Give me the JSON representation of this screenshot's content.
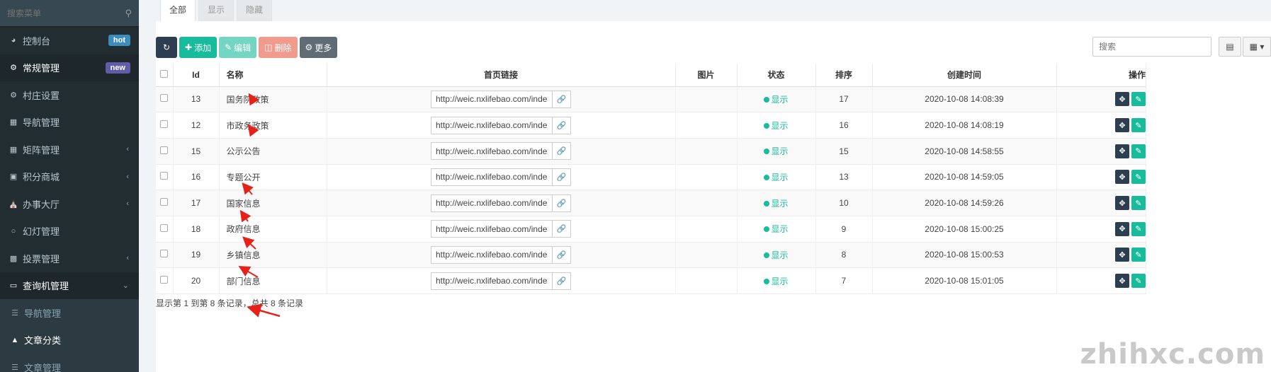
{
  "sidebar": {
    "search_placeholder": "搜索菜单",
    "items": [
      {
        "label": "控制台",
        "icon": "dashboard-icon",
        "badge": "hot"
      },
      {
        "label": "常规管理",
        "icon": "cogs-icon",
        "badge": "new"
      },
      {
        "label": "村庄设置",
        "icon": "cogs-icon"
      },
      {
        "label": "导航管理",
        "icon": "grid-icon"
      },
      {
        "label": "矩阵管理",
        "icon": "grid-icon"
      },
      {
        "label": "积分商城",
        "icon": "bag-icon"
      },
      {
        "label": "办事大厅",
        "icon": "bank-icon"
      },
      {
        "label": "幻灯管理",
        "icon": "circle-icon"
      },
      {
        "label": "投票管理",
        "icon": "image-icon"
      },
      {
        "label": "查询机管理",
        "icon": "laptop-icon"
      }
    ],
    "subitems": [
      {
        "label": "导航管理",
        "icon": "list-icon"
      },
      {
        "label": "文章分类",
        "icon": "sitemap-icon"
      },
      {
        "label": "文章管理",
        "icon": "list-icon"
      }
    ]
  },
  "tabs": [
    "全部",
    "显示",
    "隐藏"
  ],
  "toolbar": {
    "add": "添加",
    "edit": "编辑",
    "delete": "删除",
    "more": "更多"
  },
  "search": {
    "placeholder": "搜索"
  },
  "table": {
    "headers": {
      "id": "Id",
      "name": "名称",
      "link": "首页链接",
      "image": "图片",
      "status": "状态",
      "sort": "排序",
      "created": "创建时间",
      "ops": "操作"
    },
    "rows": [
      {
        "id": "13",
        "name": "国务院政策",
        "link": "http://weic.nxlifebao.com/index/q",
        "status": "显示",
        "sort": "17",
        "created": "2020-10-08 14:08:39"
      },
      {
        "id": "12",
        "name": "市政务政策",
        "link": "http://weic.nxlifebao.com/index/q",
        "status": "显示",
        "sort": "16",
        "created": "2020-10-08 14:08:19"
      },
      {
        "id": "15",
        "name": "公示公告",
        "link": "http://weic.nxlifebao.com/index/q",
        "status": "显示",
        "sort": "15",
        "created": "2020-10-08 14:58:55"
      },
      {
        "id": "16",
        "name": "专题公开",
        "link": "http://weic.nxlifebao.com/index/q",
        "status": "显示",
        "sort": "13",
        "created": "2020-10-08 14:59:05"
      },
      {
        "id": "17",
        "name": "国家信息",
        "link": "http://weic.nxlifebao.com/index/q",
        "status": "显示",
        "sort": "10",
        "created": "2020-10-08 14:59:26"
      },
      {
        "id": "18",
        "name": "政府信息",
        "link": "http://weic.nxlifebao.com/index/q",
        "status": "显示",
        "sort": "9",
        "created": "2020-10-08 15:00:25"
      },
      {
        "id": "19",
        "name": "乡镇信息",
        "link": "http://weic.nxlifebao.com/index/q",
        "status": "显示",
        "sort": "8",
        "created": "2020-10-08 15:00:53"
      },
      {
        "id": "20",
        "name": "部门信息",
        "link": "http://weic.nxlifebao.com/index/q",
        "status": "显示",
        "sort": "7",
        "created": "2020-10-08 15:01:05"
      }
    ]
  },
  "pagination": {
    "summary": "显示第 1 到第 8 条记录，总共 8 条记录"
  },
  "watermark": "zhihxc.com",
  "colors": {
    "sidebar_bg": "#222d32",
    "accent": "#18bc9c",
    "annotation_arrow": "#e8201a"
  }
}
